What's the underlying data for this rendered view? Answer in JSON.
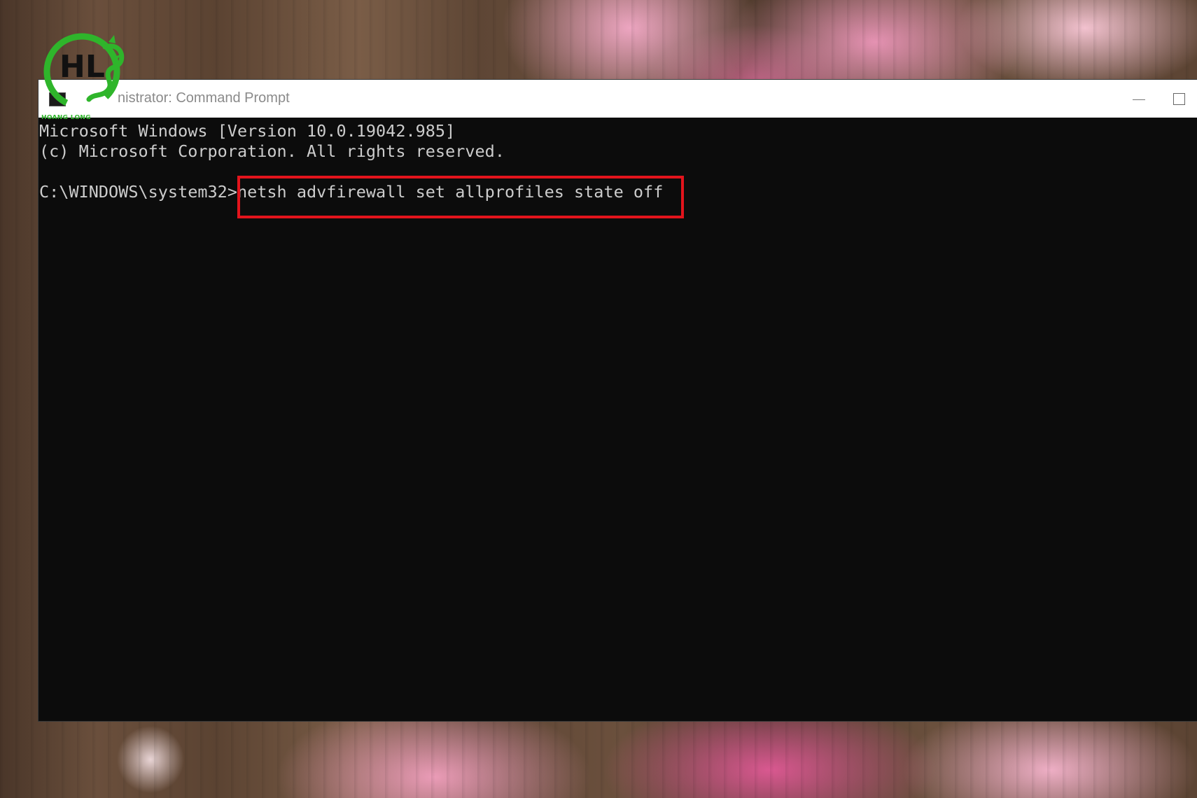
{
  "desktop": {
    "wallpaper": "wooden table with pink peonies"
  },
  "watermark": {
    "logo_text": "HL",
    "brand_text": "HOANG LONG",
    "color": "#2fb52b"
  },
  "window": {
    "title": "Administrator: Command Prompt",
    "title_visible": "nistrator: Command Prompt",
    "icon": "cmd-icon",
    "controls": {
      "minimize_icon": "minimize-icon",
      "maximize_icon": "maximize-icon"
    }
  },
  "console": {
    "lines": [
      "Microsoft Windows [Version 10.0.19042.985]",
      "(c) Microsoft Corporation. All rights reserved."
    ],
    "prompt": "C:\\WINDOWS\\system32>",
    "command": "netsh advfirewall set allprofiles state off",
    "highlight_color": "#e3141c",
    "text_color": "#cccccc",
    "background_color": "#0c0c0c"
  }
}
